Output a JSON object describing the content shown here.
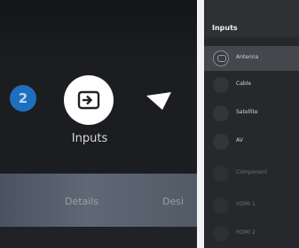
{
  "home": {
    "badge_number": "2",
    "selected_label": "Inputs",
    "bottom_labels": [
      "Details",
      "Desi"
    ]
  },
  "inputs_panel": {
    "title": "Inputs",
    "items": [
      {
        "label": "Antenna",
        "state": "selected"
      },
      {
        "label": "Cable",
        "state": "normal"
      },
      {
        "label": "Satellite",
        "state": "normal"
      },
      {
        "label": "AV",
        "state": "normal"
      },
      {
        "label": "Component",
        "state": "disabled"
      },
      {
        "label": "HDMI 1",
        "state": "disabled"
      },
      {
        "label": "HDMI 2",
        "state": "disabled"
      }
    ]
  },
  "colors": {
    "accent_blue": "#1f6fbf",
    "panel_bg": "#26282c",
    "selected_row": "#45474c"
  }
}
